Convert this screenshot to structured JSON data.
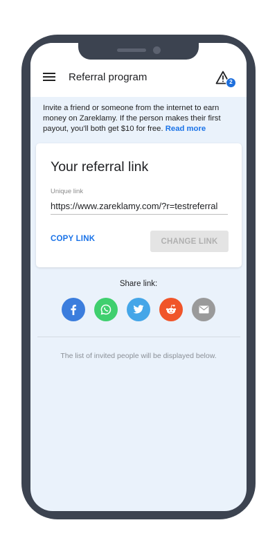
{
  "header": {
    "title": "Referral program",
    "notification_count": "2"
  },
  "intro": {
    "text": "Invite a friend or someone from the internet to earn money on Zareklamy. If the person makes their first payout, you'll both get $10 for free.",
    "link_label": "Read more"
  },
  "referral_card": {
    "title": "Your referral link",
    "field_label": "Unique link",
    "link_value": "https://www.zareklamy.com/?r=testreferral",
    "copy_label": "COPY LINK",
    "change_label": "CHANGE LINK"
  },
  "share": {
    "label": "Share link:",
    "buttons": [
      {
        "name": "facebook",
        "color": "#3b7ddd",
        "icon": "facebook-icon"
      },
      {
        "name": "whatsapp",
        "color": "#3fcf6e",
        "icon": "whatsapp-icon"
      },
      {
        "name": "twitter",
        "color": "#45a6e8",
        "icon": "twitter-icon"
      },
      {
        "name": "reddit",
        "color": "#f0552a",
        "icon": "reddit-icon"
      },
      {
        "name": "email",
        "color": "#9a9a9a",
        "icon": "email-icon"
      }
    ]
  },
  "invited": {
    "empty_text": "The list of invited people will be displayed below."
  },
  "colors": {
    "accent": "#1a73e8",
    "frame": "#3c4350",
    "screen_background": "#eaf2fb"
  }
}
